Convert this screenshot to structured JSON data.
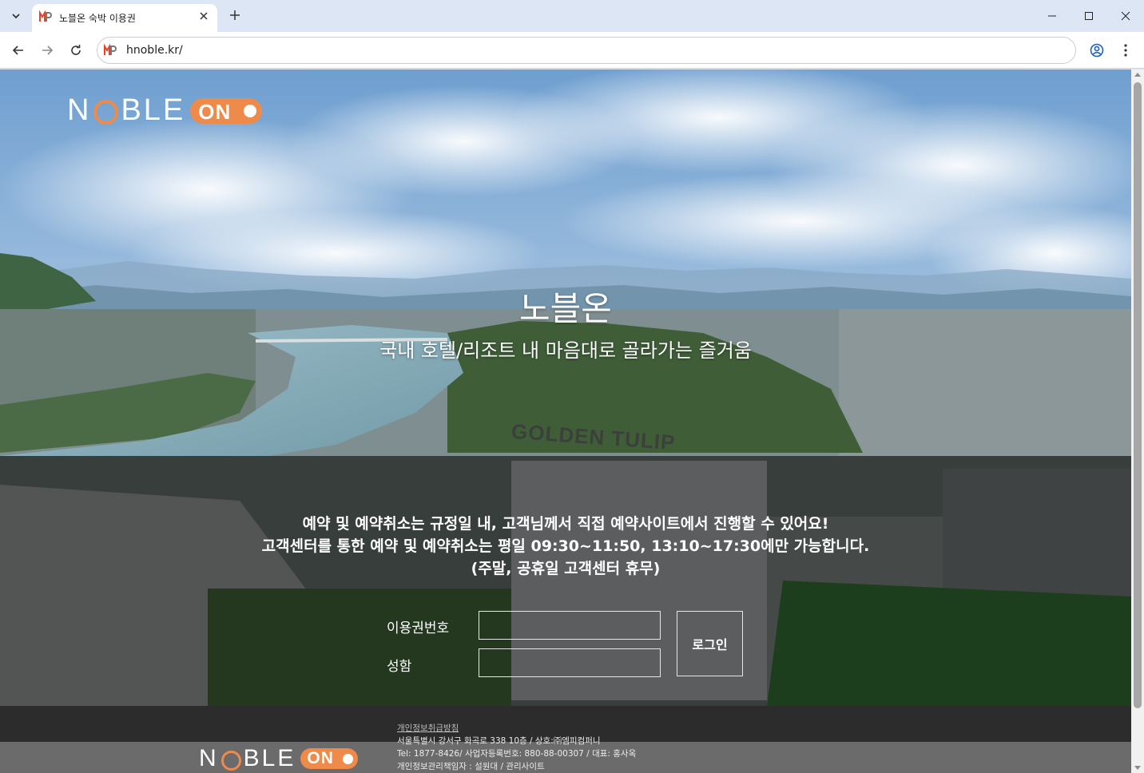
{
  "browser": {
    "tab_title": "노블온 숙박 이용권",
    "url": "hnoble.kr/",
    "icons": {
      "tab_menu": "chevron-down-icon",
      "close": "close-icon",
      "new_tab": "plus-icon",
      "back": "arrow-left-icon",
      "forward": "arrow-right-icon",
      "reload": "reload-icon",
      "profile": "profile-icon",
      "menu": "kebab-menu-icon"
    }
  },
  "brand": {
    "logo_text": "N",
    "logo_text_rest": "BLE",
    "logo_on": "ON",
    "accent_color": "#ee8a4a"
  },
  "hero": {
    "title": "노블온",
    "subtitle": "국내 호텔/리조트 내 마음대로 골라가는 즐거움",
    "building_sign": "GOLDEN TULIP"
  },
  "notice": {
    "line1": "예약 및 예약취소는 규정일 내, 고객님께서 직접 예약사이트에서 진행할 수 있어요!",
    "line2": "고객센터를 통한 예약 및 예약취소는 평일 09:30~11:50, 13:10~17:30에만 가능합니다.",
    "line3": "(주말, 공휴일 고객센터 휴무)"
  },
  "form": {
    "voucher_label": "이용권번호",
    "voucher_value": "",
    "name_label": "성함",
    "name_value": "",
    "login_label": "로그인"
  },
  "footer": {
    "privacy_link": "개인정보취급방침",
    "address": "서울특별시 강서구 화곡로 338 10층 / 상호:㈜엠피컴퍼니",
    "contact": "Tel: 1877-8426/ 사업자등록번호: 880-88-00307 / 대표: 홍사옥",
    "manager": "개인정보관리책임자 : 설원대 / 관리사이트"
  }
}
